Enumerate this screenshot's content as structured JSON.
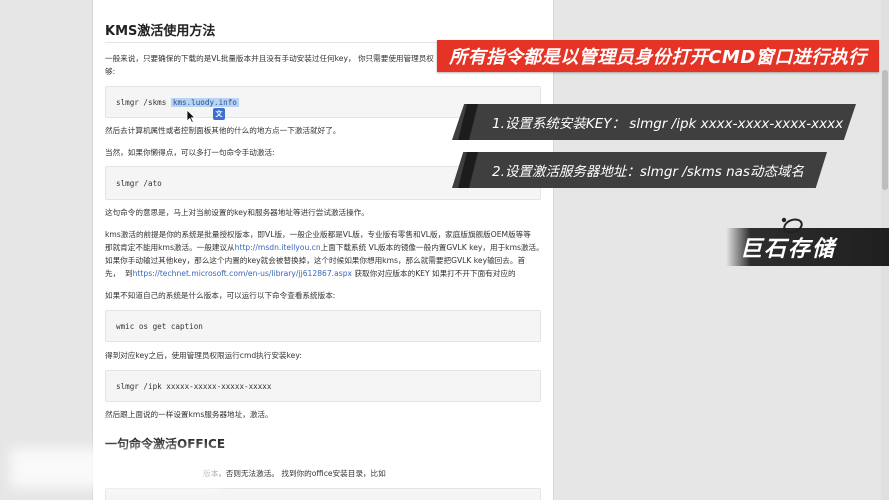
{
  "article": {
    "title": "KMS激活使用方法",
    "p1": "一般来说，只要确保的下载的是VL批量版本并且没有手动安装过任何key，  你只需要使用管理员权",
    "p1b": "够:",
    "code1_cmd": "slmgr /skms ",
    "code1_host": "kms.luody.info",
    "p2": "然后去计算机属性或者控制面板其他的什么的地方点一下激活就好了。",
    "p3": "当然，如果你懒得点，可以多打一句命令手动激活:",
    "code2": "slmgr /ato",
    "p4": "这句命令的意思是，马上对当前设置的key和服务器地址等进行尝试激活操作。",
    "p5_l1": "kms激活的前提是你的系统是批量授权版本，即VL版，一般企业版都是VL版，专业版有零售和VL版，家庭版旗舰版OEM版等等",
    "p5_l2a": "那就肯定不能用kms激活。一般建议从",
    "p5_l2link": "http://msdn.itellyou.cn",
    "p5_l2b": "上面下载系统 VL版本的镜像一般内置GVLK key，用于kms激活。",
    "p5_l3": "如果你手动输过其他key，那么这个内置的key就会被替换掉，这个时候如果你想用kms，那么就需要把GVLK key输回去。首",
    "p5_l4a": "先，  到",
    "p5_l4link": "https://technet.microsoft.com/en-us/library/jj612867.aspx",
    "p5_l4b": " 获取你对应版本的KEY 如果打不开下面有对应的",
    "p6": "如果不知道自己的系统是什么版本，可以运行以下命令查看系统版本:",
    "code3": "wmic os get caption",
    "p7": "得到对应key之后，使用管理员权限运行cmd执行安装key:",
    "code4": "slmgr /ipk xxxxx-xxxxx-xxxxx-xxxxx",
    "p8": "然后跟上面说的一样设置kms服务器地址，激活。",
    "h2": "一句命令激活OFFICE",
    "p9": "版本，否则无法激活。 找到你的office安装目录，比如"
  },
  "overlay": {
    "banner": "所有指令都是以管理员身份打开CMD窗口进行执行",
    "step1": "1.设置系统安装KEY： slmgr /ipk xxxx-xxxx-xxxx-xxxx",
    "step2": "2.设置激活服务器地址：slmgr /skms nas动态域名",
    "brand": "巨石存储"
  },
  "icons": {
    "cursor": "mouse-cursor-icon",
    "translate": "translate-icon",
    "brand_logo": "orbit-logo-icon"
  },
  "colors": {
    "banner_red": "#e53426",
    "step_gray": "#3f3f3f",
    "link_blue": "#3a67b6",
    "highlight": "#b9d4f3"
  }
}
